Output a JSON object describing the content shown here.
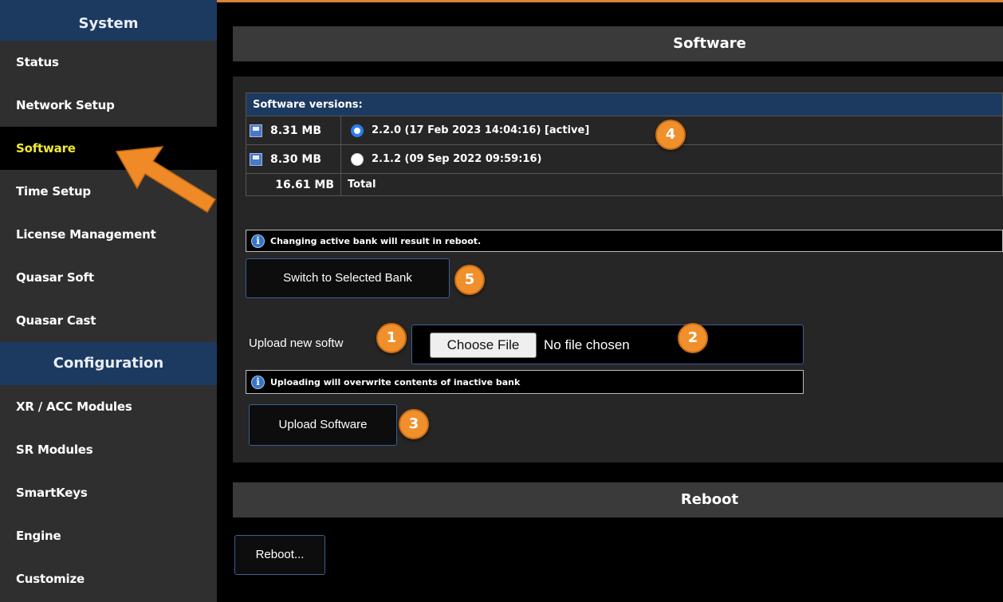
{
  "sidebar": {
    "system_header": "System",
    "config_header": "Configuration",
    "system_items": [
      "Status",
      "Network Setup",
      "Software",
      "Time Setup",
      "License Management",
      "Quasar Soft",
      "Quasar Cast"
    ],
    "config_items": [
      "XR / ACC Modules",
      "SR Modules",
      "SmartKeys",
      "Engine",
      "Customize"
    ],
    "active_item": "Software"
  },
  "software_panel": {
    "title": "Software",
    "versions_header": "Software versions:",
    "versions": [
      {
        "size": "8.31 MB",
        "label": "2.2.0 (17 Feb 2023 14:04:16) [active]",
        "selected": true
      },
      {
        "size": "8.30 MB",
        "label": "2.1.2 (09 Sep 2022 09:59:16)",
        "selected": false
      }
    ],
    "total_size": "16.61 MB",
    "total_label": "Total",
    "bank_notice": "Changing active bank will result in reboot.",
    "switch_button": "Switch to Selected Bank",
    "upload_label": "Upload new softw",
    "choose_file_button": "Choose File",
    "no_file_text": "No file chosen",
    "upload_notice": "Uploading will overwrite contents of inactive bank",
    "upload_button": "Upload Software"
  },
  "reboot_panel": {
    "title": "Reboot",
    "reboot_button": "Reboot..."
  },
  "annotations": [
    "1",
    "2",
    "3",
    "4",
    "5"
  ],
  "colors": {
    "accent_orange": "#f0902c",
    "nav_header": "#1c3a60",
    "active_item_text": "#f2ea2e",
    "radio_selected": "#2d7bf0"
  },
  "icons": {
    "arrow": "orange-pointer-arrow-icon",
    "disk": "floppy-disk-icon",
    "info": "info-icon"
  }
}
